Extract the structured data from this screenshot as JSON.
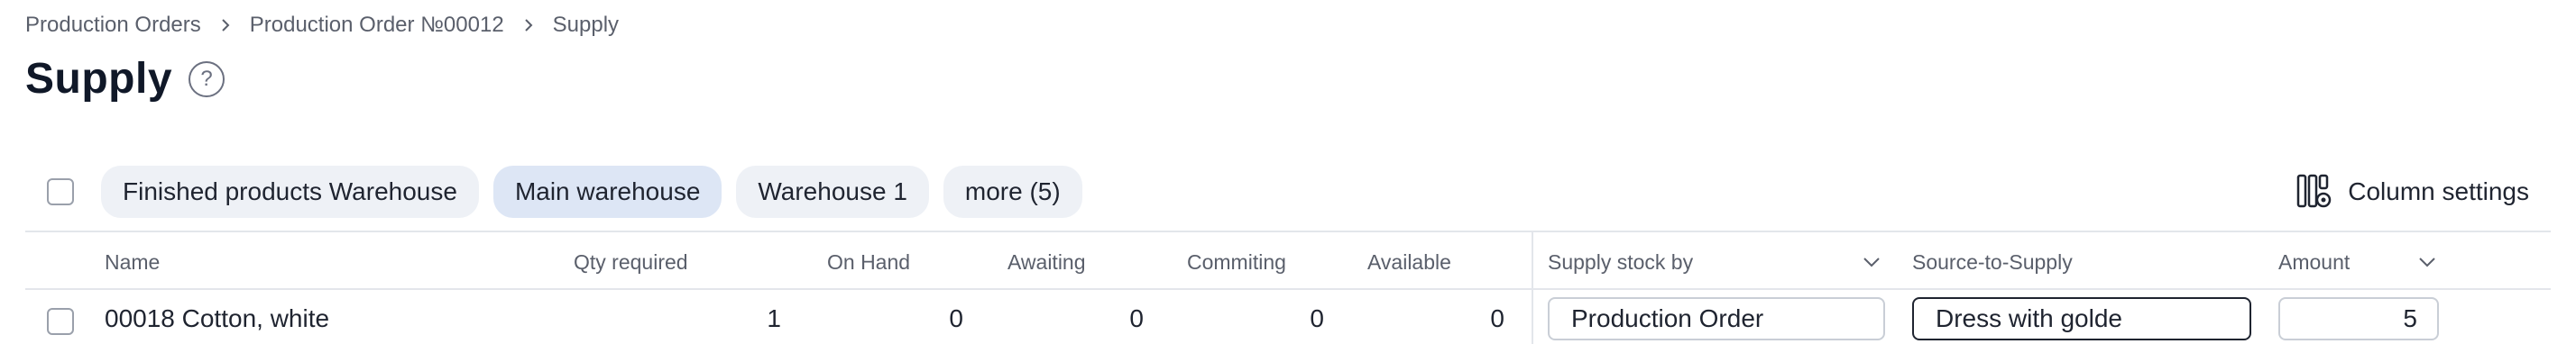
{
  "breadcrumb": {
    "items": [
      "Production Orders",
      "Production Order №00012",
      "Supply"
    ]
  },
  "page": {
    "title": "Supply",
    "help_glyph": "?"
  },
  "filters": {
    "chips": [
      "Finished products Warehouse",
      "Main warehouse",
      "Warehouse 1",
      "more (5)"
    ],
    "active_chip": "Main warehouse"
  },
  "toolbar": {
    "column_settings_label": "Column settings"
  },
  "table": {
    "columns": {
      "name": "Name",
      "qty_required": "Qty required",
      "on_hand": "On Hand",
      "awaiting": "Awaiting",
      "commiting": "Commiting",
      "available": "Available",
      "supply_stock_by": "Supply stock by",
      "source_to_supply": "Source-to-Supply",
      "amount": "Amount"
    },
    "rows": [
      {
        "name": "00018 Cotton, white",
        "qty_required": "1",
        "on_hand": "0",
        "awaiting": "0",
        "commiting": "0",
        "available": "0",
        "supply_stock_by": "Production Order",
        "source_to_supply": "Dress with golde",
        "amount": "5"
      }
    ]
  },
  "colors": {
    "chip_bg": "#eef1f6",
    "chip_active_bg": "#dde6f5",
    "text": "#1f2430",
    "muted": "#5a5f6b"
  }
}
